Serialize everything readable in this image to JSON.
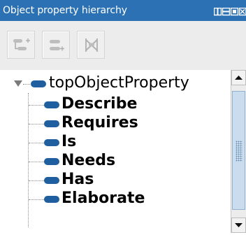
{
  "window": {
    "title": "Object property hierarchy",
    "title_bar_color": "#2b71b3",
    "controls": [
      "tile-icon",
      "minimize-icon",
      "maximize-icon",
      "close-icon"
    ]
  },
  "toolbar": {
    "buttons": [
      {
        "name": "add-subproperty-button",
        "icon": "add-subproperty-icon"
      },
      {
        "name": "add-sibling-property-button",
        "icon": "add-sibling-property-icon"
      },
      {
        "name": "delete-property-button",
        "icon": "delete-icon"
      }
    ]
  },
  "tree": {
    "root": {
      "label": "topObjectProperty",
      "expanded": true
    },
    "children": [
      {
        "label": "Describe"
      },
      {
        "label": "Requires"
      },
      {
        "label": "Is"
      },
      {
        "label": "Needs"
      },
      {
        "label": "Has"
      },
      {
        "label": "Elaborate"
      }
    ],
    "property_icon_color": "#1f5fa0"
  },
  "scrollbar": {
    "thumb_color": "#c9ddef"
  }
}
